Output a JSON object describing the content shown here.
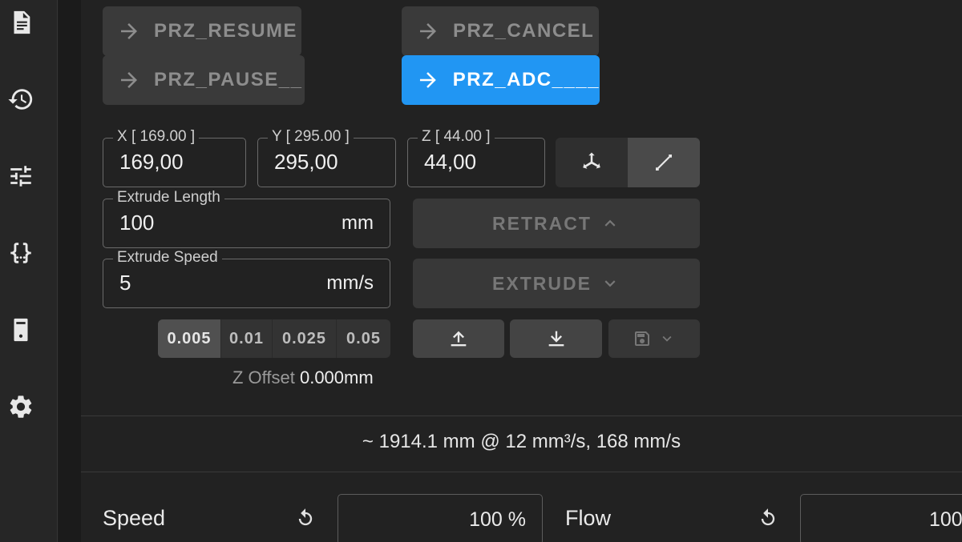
{
  "sidebar": {
    "icons": [
      "file-document-icon",
      "history-icon",
      "tune-icon",
      "code-braces-icon",
      "printer-icon",
      "settings-gear-icon"
    ]
  },
  "macros": {
    "resume": "PRZ_RESUME",
    "cancel": "PRZ_CANCEL",
    "pause": "PRZ_PAUSE__",
    "adc": "PRZ_ADC____"
  },
  "position": {
    "x_label": "X [ 169.00 ]",
    "x_value": "169,00",
    "y_label": "Y [ 295.00 ]",
    "y_value": "295,00",
    "z_label": "Z [ 44.00 ]",
    "z_value": "44,00"
  },
  "extrude": {
    "length_label": "Extrude Length",
    "length_value": "100",
    "length_unit": "mm",
    "speed_label": "Extrude Speed",
    "speed_value": "5",
    "speed_unit": "mm/s",
    "retract_label": "RETRACT",
    "extrude_label": "EXTRUDE"
  },
  "zsteps": [
    "0.005",
    "0.01",
    "0.025",
    "0.05"
  ],
  "zsteps_selected": "0.005",
  "zoffset": {
    "label": "Z Offset",
    "value": "0.000mm"
  },
  "estimate": "~ 1914.1 mm @ 12 mm³/s, 168 mm/s",
  "speed": {
    "label": "Speed",
    "value": "100 %"
  },
  "flow": {
    "label": "Flow",
    "value": "100"
  },
  "colors": {
    "accent": "#2196f3",
    "background": "#222222",
    "sidebar": "#262626"
  }
}
